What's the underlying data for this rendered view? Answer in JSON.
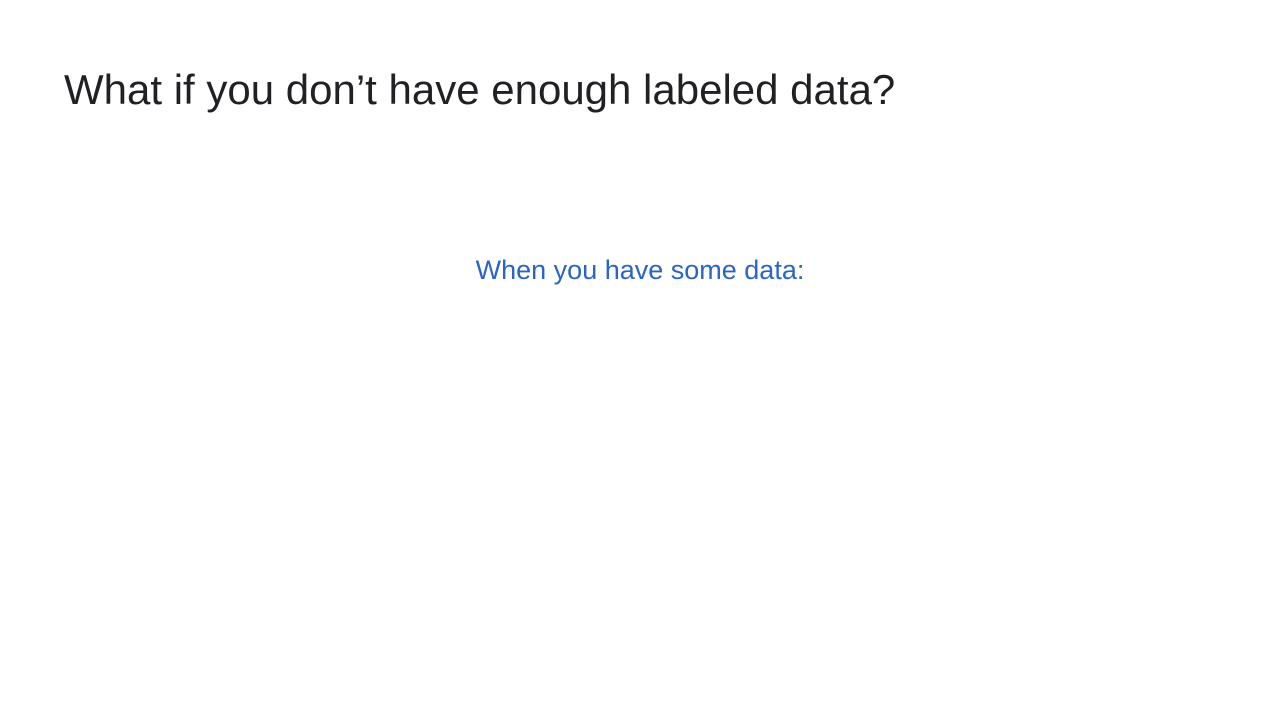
{
  "slide": {
    "title": "What if you don’t have enough labeled data?",
    "subheading": "When you have some data:"
  },
  "colors": {
    "title": "#202124",
    "subheading": "#2a64c5",
    "background": "#ffffff"
  }
}
